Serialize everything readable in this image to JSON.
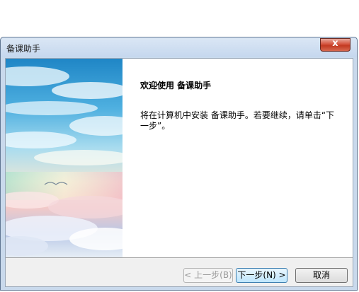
{
  "window": {
    "title": "备课助手",
    "close_label": "x"
  },
  "content": {
    "heading": "欢迎使用 备课助手",
    "body": "将在计算机中安装 备课助手。若要继续，请单击“下一步”。"
  },
  "buttons": {
    "back_label": "< 上一步(B)",
    "next_label": "下一步(N) >",
    "cancel_label": "取消"
  }
}
